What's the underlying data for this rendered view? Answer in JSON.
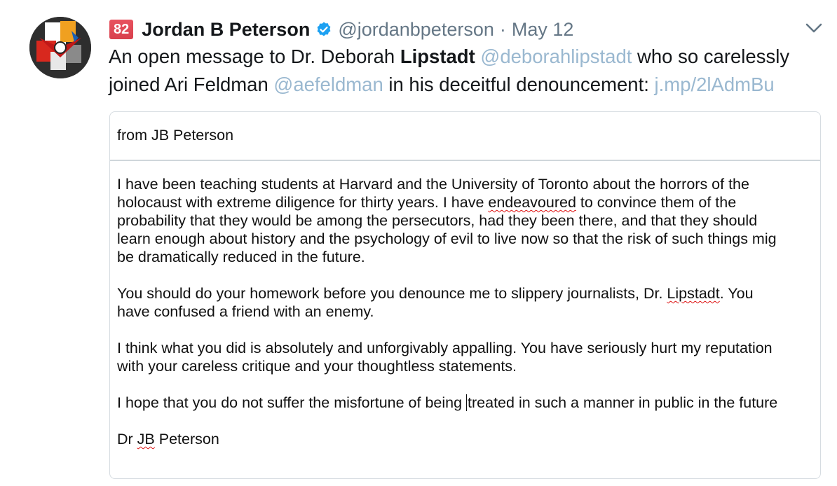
{
  "tweet": {
    "notification_count": "82",
    "author_name": "Jordan B Peterson",
    "handle": "@jordanbpeterson",
    "separator": "·",
    "date": "May 12",
    "text": {
      "part1": "An open message to Dr. Deborah ",
      "bold": "Lipstadt",
      "space1": " ",
      "mention1": "@deborahlipstadt",
      "part2": " who so carelessly joined Ari Feldman ",
      "mention2": "@aefeldman",
      "part3": " in his deceitful denouncement: ",
      "link": "j.mp/2lAdmBu"
    }
  },
  "letter": {
    "from": "from JB Peterson",
    "p1_lines": [
      "I have been teaching students at Harvard and the University of Toronto about the horrors of the",
      "holocaust with extreme diligence for thirty years. I have ",
      "endeavoured",
      " to convince them of the",
      "probability that they would be among the persecutors, had they been there, and that they should",
      "learn enough about history and the psychology of evil to live now so that the risk of such things mig",
      "be dramatically reduced in the future."
    ],
    "p2": {
      "line1a": "You should do your homework before you denounce me to slippery journalists, Dr. ",
      "line1b": "Lipstadt",
      "line1c": ". You",
      "line2": "have confused a friend with an enemy."
    },
    "p3_lines": [
      "I think what you did is absolutely and unforgivably appalling. You have seriously hurt my reputation",
      "with your careless critique and your thoughtless statements."
    ],
    "p4a": "I hope that you do not suffer the misfortune of being ",
    "p4b": "treated in such a manner in public in the future",
    "sig_a": "Dr ",
    "sig_b": "JB",
    "sig_c": " Peterson"
  },
  "colors": {
    "badge": "#e0245e",
    "verified": "#1da1f2",
    "link": "#9ab8d0",
    "muted": "#657786"
  },
  "icons": {
    "verified": "verified-badge-icon",
    "caret": "chevron-down-icon",
    "avatar": "avatar-image"
  }
}
